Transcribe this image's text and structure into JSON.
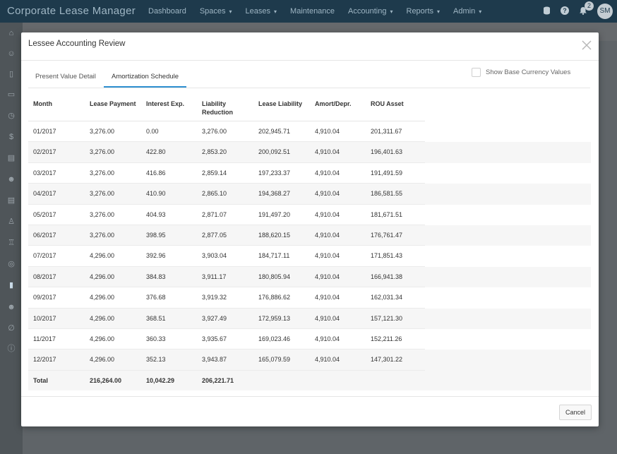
{
  "app": {
    "title": "Corporate Lease Manager",
    "nav": [
      {
        "label": "Dashboard",
        "dropdown": false
      },
      {
        "label": "Spaces",
        "dropdown": true
      },
      {
        "label": "Leases",
        "dropdown": true
      },
      {
        "label": "Maintenance",
        "dropdown": false
      },
      {
        "label": "Accounting",
        "dropdown": true
      },
      {
        "label": "Reports",
        "dropdown": true
      },
      {
        "label": "Admin",
        "dropdown": true
      }
    ],
    "notifications_count": "2",
    "user_initials": "SM"
  },
  "modal": {
    "title": "Lessee Accounting Review",
    "close_icon": "close-icon",
    "tabs": [
      {
        "label": "Present Value Detail",
        "active": false
      },
      {
        "label": "Amortization Schedule",
        "active": true
      }
    ],
    "show_base_currency_label": "Show Base Currency Values",
    "show_base_currency_checked": false,
    "columns": [
      "Month",
      "Lease Payment",
      "Interest Exp.",
      "Liability Reduction",
      "Lease Liability",
      "Amort/Depr.",
      "ROU Asset"
    ],
    "rows": [
      [
        "01/2017",
        "3,276.00",
        "0.00",
        "3,276.00",
        "202,945.71",
        "4,910.04",
        "201,311.67"
      ],
      [
        "02/2017",
        "3,276.00",
        "422.80",
        "2,853.20",
        "200,092.51",
        "4,910.04",
        "196,401.63"
      ],
      [
        "03/2017",
        "3,276.00",
        "416.86",
        "2,859.14",
        "197,233.37",
        "4,910.04",
        "191,491.59"
      ],
      [
        "04/2017",
        "3,276.00",
        "410.90",
        "2,865.10",
        "194,368.27",
        "4,910.04",
        "186,581.55"
      ],
      [
        "05/2017",
        "3,276.00",
        "404.93",
        "2,871.07",
        "191,497.20",
        "4,910.04",
        "181,671.51"
      ],
      [
        "06/2017",
        "3,276.00",
        "398.95",
        "2,877.05",
        "188,620.15",
        "4,910.04",
        "176,761.47"
      ],
      [
        "07/2017",
        "4,296.00",
        "392.96",
        "3,903.04",
        "184,717.11",
        "4,910.04",
        "171,851.43"
      ],
      [
        "08/2017",
        "4,296.00",
        "384.83",
        "3,911.17",
        "180,805.94",
        "4,910.04",
        "166,941.38"
      ],
      [
        "09/2017",
        "4,296.00",
        "376.68",
        "3,919.32",
        "176,886.62",
        "4,910.04",
        "162,031.34"
      ],
      [
        "10/2017",
        "4,296.00",
        "368.51",
        "3,927.49",
        "172,959.13",
        "4,910.04",
        "157,121.30"
      ],
      [
        "11/2017",
        "4,296.00",
        "360.33",
        "3,935.67",
        "169,023.46",
        "4,910.04",
        "152,211.26"
      ],
      [
        "12/2017",
        "4,296.00",
        "352.13",
        "3,943.87",
        "165,079.59",
        "4,910.04",
        "147,301.22"
      ]
    ],
    "total": {
      "label": "Total",
      "lease_payment": "216,264.00",
      "interest_exp": "10,042.29",
      "liability_reduction": "206,221.71"
    },
    "cancel_label": "Cancel"
  },
  "sidebar_icons": [
    "home-icon",
    "users-icon",
    "building-icon",
    "lease-icon",
    "clock-icon",
    "dollar-icon",
    "document-icon",
    "group-icon",
    "file-icon",
    "person-icon",
    "money-bag-icon",
    "coins-icon",
    "book-icon",
    "user-plus-icon",
    "paperclip-icon",
    "info-icon"
  ]
}
